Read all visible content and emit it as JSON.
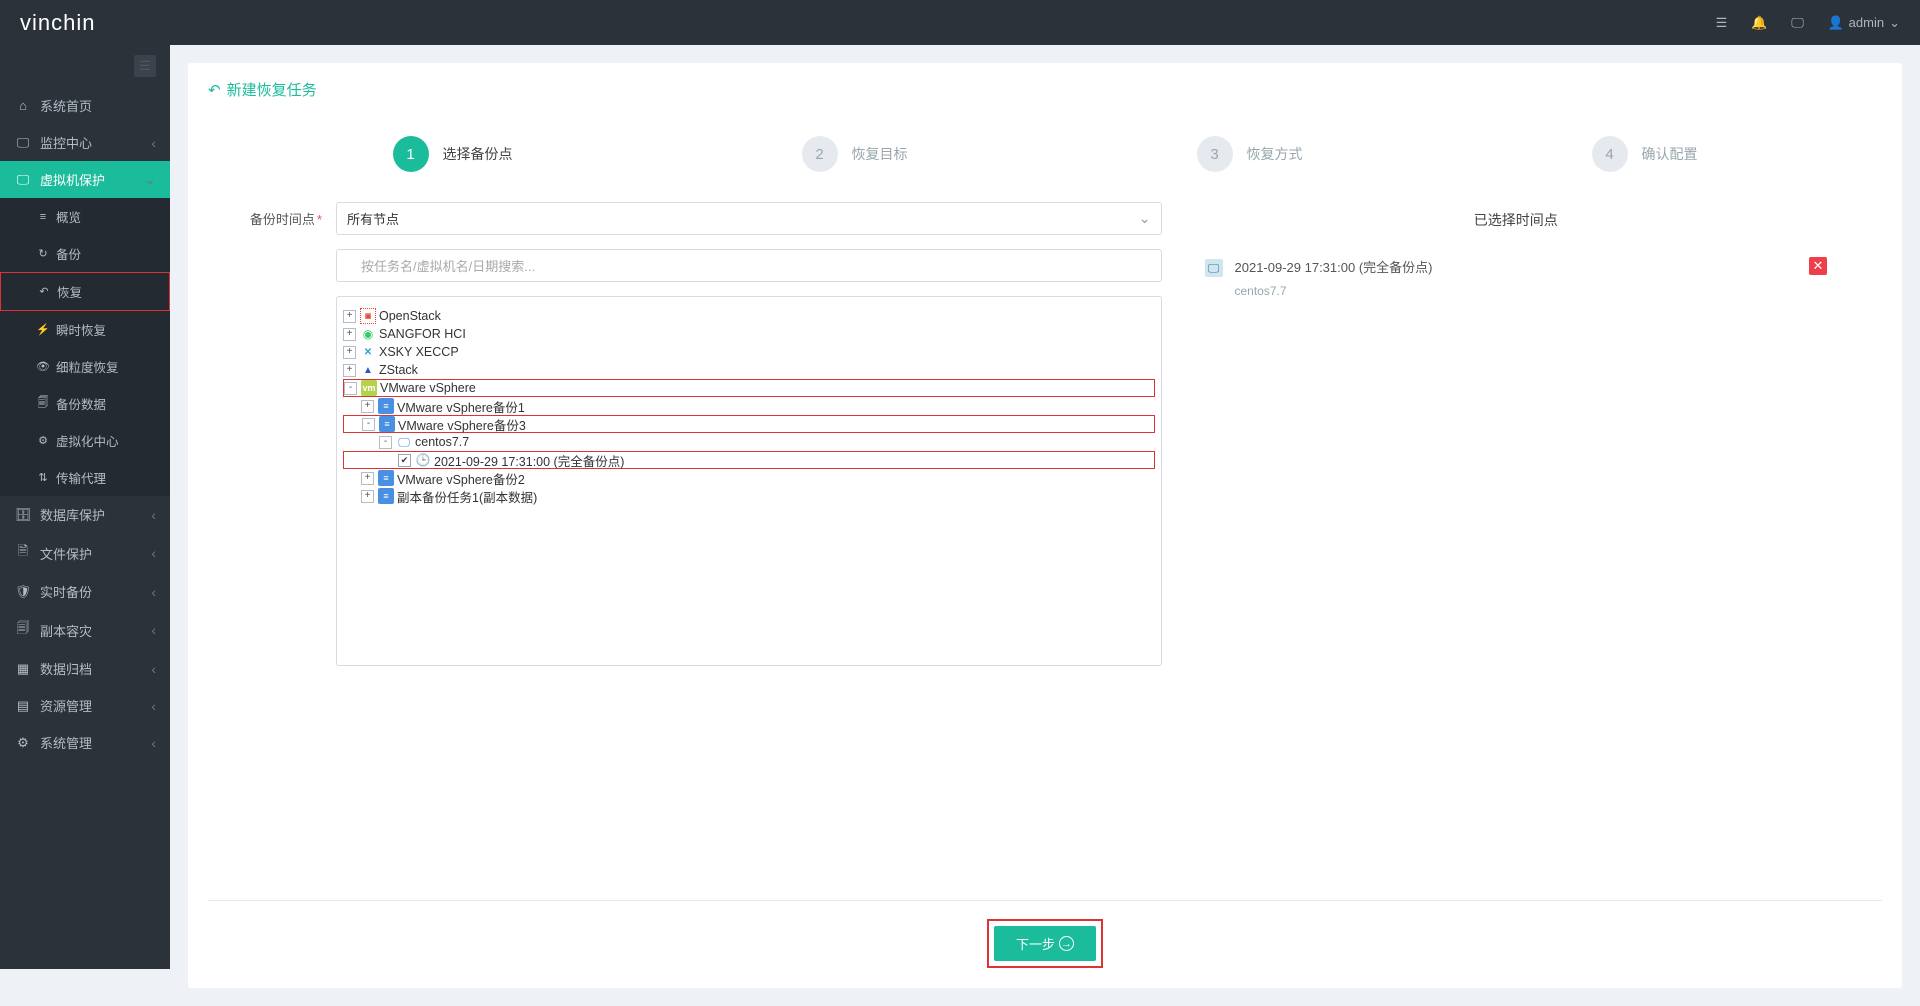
{
  "brand": "vinchin",
  "header": {
    "user_label": "admin"
  },
  "sidebar": {
    "items": [
      {
        "icon": "⌂",
        "label": "系统首页",
        "has_children": false
      },
      {
        "icon": "🖵",
        "label": "监控中心",
        "has_children": true
      },
      {
        "icon": "🖵",
        "label": "虚拟机保护",
        "has_children": true,
        "active": true,
        "children": [
          {
            "icon": "≡",
            "label": "概览"
          },
          {
            "icon": "↻",
            "label": "备份"
          },
          {
            "icon": "↶",
            "label": "恢复",
            "selected": true
          },
          {
            "icon": "⚡",
            "label": "瞬时恢复"
          },
          {
            "icon": "👁",
            "label": "细粒度恢复"
          },
          {
            "icon": "🗐",
            "label": "备份数据"
          },
          {
            "icon": "⚙",
            "label": "虚拟化中心"
          },
          {
            "icon": "⇅",
            "label": "传输代理"
          }
        ]
      },
      {
        "icon": "🗄",
        "label": "数据库保护",
        "has_children": true
      },
      {
        "icon": "🗎",
        "label": "文件保护",
        "has_children": true
      },
      {
        "icon": "🛡",
        "label": "实时备份",
        "has_children": true
      },
      {
        "icon": "🗐",
        "label": "副本容灾",
        "has_children": true
      },
      {
        "icon": "▦",
        "label": "数据归档",
        "has_children": true
      },
      {
        "icon": "▤",
        "label": "资源管理",
        "has_children": true
      },
      {
        "icon": "⚙",
        "label": "系统管理",
        "has_children": true
      }
    ]
  },
  "page": {
    "title": "新建恢复任务",
    "steps": [
      {
        "num": "1",
        "label": "选择备份点",
        "active": true
      },
      {
        "num": "2",
        "label": "恢复目标"
      },
      {
        "num": "3",
        "label": "恢复方式"
      },
      {
        "num": "4",
        "label": "确认配置"
      }
    ],
    "field_backup_point": "备份时间点",
    "select_value": "所有节点",
    "search_placeholder": "按任务名/虚拟机名/日期搜索...",
    "tree": {
      "openstack": "OpenStack",
      "sangfor": "SANGFOR HCI",
      "xsky": "XSKY XECCP",
      "zstack": "ZStack",
      "vmware": "VMware vSphere",
      "vmw_b1": "VMware vSphere备份1",
      "vmw_b3": "VMware vSphere备份3",
      "vm_centos": "centos7.7",
      "point": "2021-09-29 17:31:00 (完全备份点)",
      "vmw_b2": "VMware vSphere备份2",
      "replica": "副本备份任务1(副本数据)"
    },
    "selected_title": "已选择时间点",
    "selected_item": {
      "title": "2021-09-29 17:31:00 (完全备份点)",
      "sub": "centos7.7"
    },
    "btn_next": "下一步"
  }
}
